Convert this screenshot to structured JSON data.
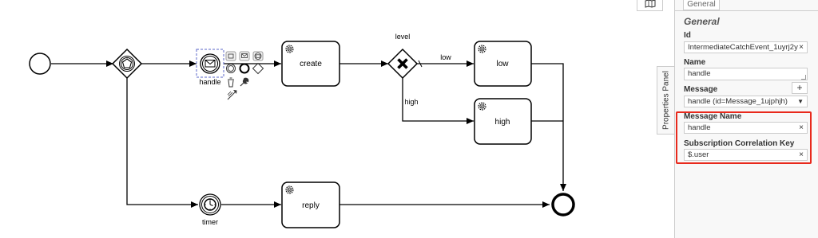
{
  "diagram": {
    "nodes": {
      "handle_label": "handle",
      "create_label": "create",
      "gateway_label": "level",
      "low_task_label": "low",
      "high_task_label": "high",
      "reply_label": "reply",
      "timer_label": "timer"
    },
    "flows": {
      "low_label": "low",
      "high_label": "high"
    }
  },
  "canvas_tools": {
    "map_icon": "map-icon"
  },
  "properties_panel": {
    "tab_label": "Properties Panel",
    "general_tab": "General",
    "group_title": "General",
    "id_label": "Id",
    "id_value": "IntermediateCatchEvent_1uyrj2y",
    "name_label": "Name",
    "name_value": "handle",
    "message_label": "Message",
    "message_add_label": "+",
    "message_value": "handle (id=Message_1ujphjh)",
    "message_name_label": "Message Name",
    "message_name_value": "handle",
    "correlation_label": "Subscription Correlation Key",
    "correlation_value": "$.user",
    "clear_symbol": "×",
    "dropdown_symbol": "▼"
  },
  "colors": {
    "highlight": "#e8291c",
    "selection": "#5b67c8",
    "stroke": "#000000"
  }
}
